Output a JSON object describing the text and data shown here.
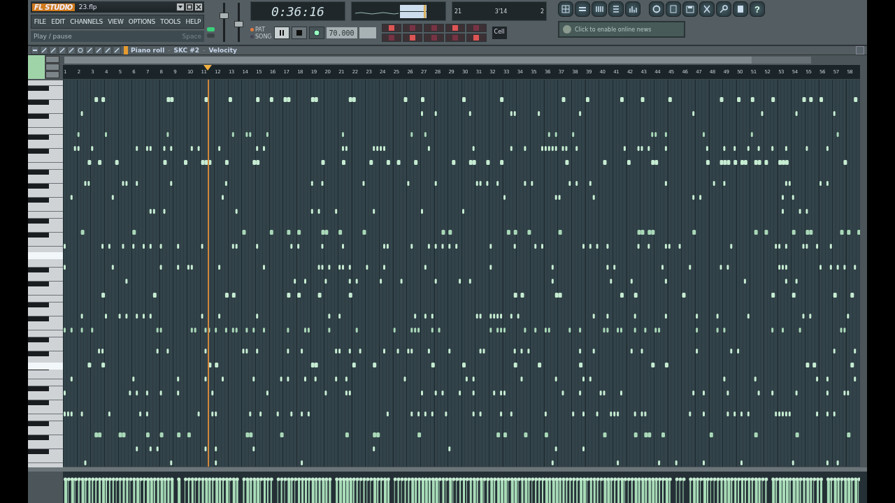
{
  "window": {
    "logo": "FL STUDIO",
    "file": "23.flp"
  },
  "menu": [
    "FILE",
    "EDIT",
    "CHANNELS",
    "VIEW",
    "OPTIONS",
    "TOOLS",
    "HELP"
  ],
  "hint": {
    "text": "Play / pause",
    "shortcut": "Space"
  },
  "sliders": [
    {
      "level": 0.7
    },
    {
      "level": 0.45
    }
  ],
  "time": "0:36:16",
  "monitor": {
    "a": "21",
    "b": "3'14",
    "c": "2"
  },
  "mode": [
    "PAT",
    "SONG"
  ],
  "transport": {
    "playing": true
  },
  "tempo": "70.000",
  "snap": "Cell",
  "news": "Click to enable online news",
  "help": "?",
  "piano_roll": {
    "title": "Piano roll",
    "sep1": "-",
    "channel": "SKC #2",
    "sep2": "-",
    "target": "Velocity"
  },
  "bars": [
    "1",
    "2",
    "3",
    "4",
    "5",
    "6",
    "7",
    "8",
    "9",
    "10",
    "11",
    "12",
    "13",
    "14",
    "15",
    "16",
    "17",
    "18",
    "19",
    "20",
    "21",
    "22",
    "23",
    "24",
    "25",
    "26",
    "27",
    "28",
    "29",
    "30",
    "31",
    "32",
    "33",
    "34",
    "35",
    "36",
    "37",
    "38",
    "39",
    "40",
    "41",
    "42",
    "43",
    "44",
    "45",
    "46",
    "47",
    "48",
    "49",
    "50",
    "51",
    "52",
    "53",
    "54",
    "55",
    "56",
    "57",
    "58"
  ],
  "playhead": {
    "level": 0.182
  }
}
